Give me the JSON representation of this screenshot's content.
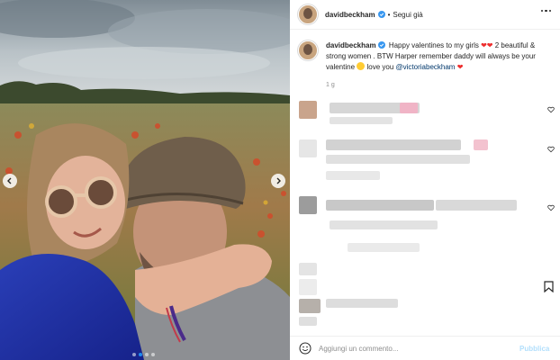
{
  "post": {
    "username": "davidbeckham",
    "separator": "•",
    "follow_state": "Segui già",
    "more_icon": "more-horizontal-icon",
    "caption": {
      "username": "davidbeckham",
      "part1": "Happy valentines to my girls",
      "part2": "2 beautiful & strong women . BTW Harper remember daddy will always be your valentine",
      "part3": "love you",
      "mention": "@victoriabeckham",
      "heart": "❤"
    },
    "age": "1 g"
  },
  "carousel": {
    "prev_icon": "chevron-left-icon",
    "next_icon": "chevron-right-icon",
    "dots": [
      false,
      true,
      false,
      false
    ],
    "active_color": "#1e8cf0"
  },
  "comment_bar": {
    "placeholder": "Aggiungi un commento...",
    "publish_label": "Pubblica"
  },
  "colors": {
    "link": "#00376b",
    "publish_disabled": "#b2dffc",
    "heart": "#ed2d2d"
  }
}
